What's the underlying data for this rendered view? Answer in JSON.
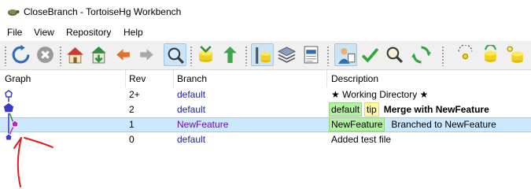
{
  "window": {
    "title": "CloseBranch - TortoiseHg Workbench"
  },
  "menu": [
    "File",
    "View",
    "Repository",
    "Help"
  ],
  "toolbar": {
    "buttons": [
      "refresh-icon",
      "stop-icon",
      "home-icon",
      "pull-icon",
      "back-icon",
      "forward-icon",
      "filter-icon",
      "incoming-icon",
      "merge-icon",
      "graph-view-icon",
      "stack-icon",
      "log-icon",
      "user-icon",
      "commit-icon",
      "search-icon",
      "sync-icon",
      "shelve-icon",
      "patch-icon",
      "repo-icon"
    ]
  },
  "table": {
    "headers": {
      "graph": "Graph",
      "rev": "Rev",
      "branch": "Branch",
      "description": "Description"
    },
    "rows": [
      {
        "rev": "2+",
        "branch": "default",
        "description": "★ Working Directory ★",
        "tags": []
      },
      {
        "rev": "2",
        "branch": "default",
        "description": "Merge with NewFeature",
        "tags": [
          "default",
          "tip"
        ]
      },
      {
        "rev": "1",
        "branch": "NewFeature",
        "description": "Branched to NewFeature",
        "tags": [
          "NewFeature"
        ]
      },
      {
        "rev": "0",
        "branch": "default",
        "description": "Added test file",
        "tags": []
      }
    ]
  },
  "colors": {
    "selected_row": "#cce8ff",
    "branch_tag": "#b4f0a4",
    "tip_tag": "#fff8a8",
    "default_node": "#3a3ac8",
    "newfeature_node": "#c020c0",
    "annotation": "#e21b1b"
  }
}
